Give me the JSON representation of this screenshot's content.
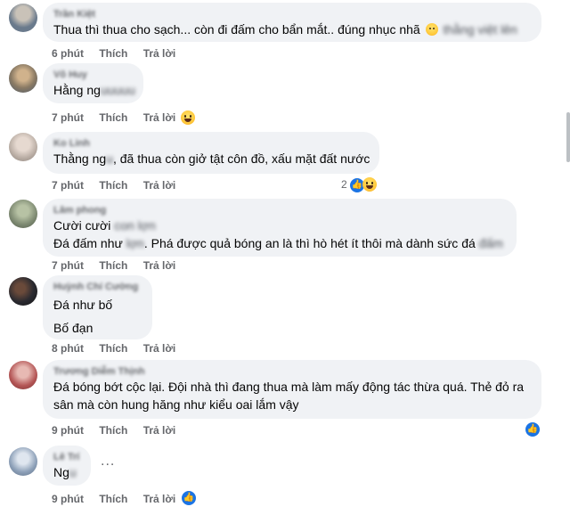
{
  "comments": [
    {
      "author": "Trần Kiệt",
      "avatar_color": "#6a7a8c",
      "text_clear": "Thua thì thua cho sạch... còn đi đấm cho bẩn mắt.. đúng nhục nhã",
      "text_blur": "thằng việt lên",
      "time": "6 phút",
      "like": "Thích",
      "reply": "Trả lời"
    },
    {
      "author": "Võ Huy",
      "avatar_color": "#8a7a64",
      "text_clear": "Hằng ng",
      "text_blur": "uuuuu",
      "time": "7 phút",
      "like": "Thích",
      "reply": "Trả lời"
    },
    {
      "author": "Ko Linh",
      "avatar_color": "#b5a9a0",
      "text_clear": "Thằng ng",
      "text_blur": "u",
      "text_clear2": ", đã thua còn giở tật côn đồ, xấu mặt đất nước",
      "time": "7 phút",
      "like": "Thích",
      "reply": "Trả lời",
      "reaction_count": "2"
    },
    {
      "author": "Lâm phong",
      "avatar_color": "#7e8a72",
      "line1_clear": "Cười cười",
      "line1_blur": "con lợn",
      "line2_clear": "Đá đấm như",
      "line2_blur": "lợn",
      "line2_clear2": ". Phá được quả bóng an là thì hò hét ít thôi mà dành sức đá",
      "line2_blur2": "đấm",
      "time": "7 phút",
      "like": "Thích",
      "reply": "Trả lời"
    },
    {
      "author": "Huỳnh Chí Cường",
      "avatar_color": "#2a2a30",
      "line1": "Đá như bố",
      "line2": "Bố đạn",
      "time": "8 phút",
      "like": "Thích",
      "reply": "Trả lời"
    },
    {
      "author": "Trương Diễm Thịnh",
      "avatar_color": "#b45656",
      "text": "Đá bóng bớt cộc lại. Đội nhà thì đang thua mà làm mấy động tác thừa quá. Thẻ đỏ ra sân mà còn hung hăng như kiểu oai lắm vậy",
      "time": "9 phút",
      "like": "Thích",
      "reply": "Trả lời"
    },
    {
      "author": "Lê Trí",
      "avatar_color": "#8da0b8",
      "text_clear": "Ng",
      "text_blur": "u",
      "time": "9 phút",
      "like": "Thích",
      "reply": "Trả lời",
      "more": "..."
    }
  ],
  "icons": {
    "like": "like-icon",
    "haha": "haha-icon",
    "emoji": "smirk-emoji-icon"
  },
  "colors": {
    "bubble": "#f0f2f5",
    "meta": "#65676b",
    "like_blue": "#1b74e4"
  }
}
